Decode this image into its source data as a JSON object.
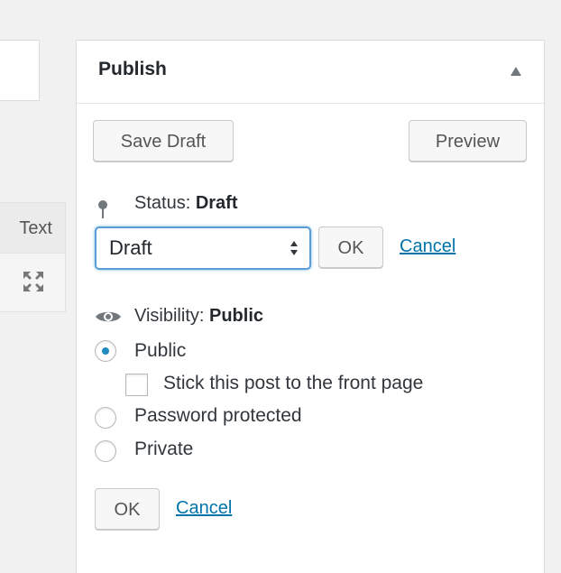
{
  "editor": {
    "text_tab_label": "Text",
    "fullscreen_icon": "fullscreen-icon"
  },
  "publish_box": {
    "title": "Publish",
    "toggle_icon": "triangle-up-icon",
    "save_draft_label": "Save Draft",
    "preview_label": "Preview",
    "status": {
      "icon": "pin-icon",
      "label": "Status:",
      "value": "Draft",
      "select_value": "Draft",
      "ok_label": "OK",
      "cancel_label": "Cancel"
    },
    "visibility": {
      "icon": "eye-icon",
      "label": "Visibility:",
      "value": "Public",
      "options": [
        {
          "label": "Public",
          "checked": true
        },
        {
          "label": "Password protected",
          "checked": false
        },
        {
          "label": "Private",
          "checked": false
        }
      ],
      "sticky_label": "Stick this post to the front page",
      "sticky_checked": false,
      "ok_label": "OK",
      "cancel_label": "Cancel"
    }
  },
  "colors": {
    "background": "#f1f1f1",
    "link": "#0073aa",
    "focus": "#5b9dd9",
    "radio_dot": "#1e8cbe"
  }
}
